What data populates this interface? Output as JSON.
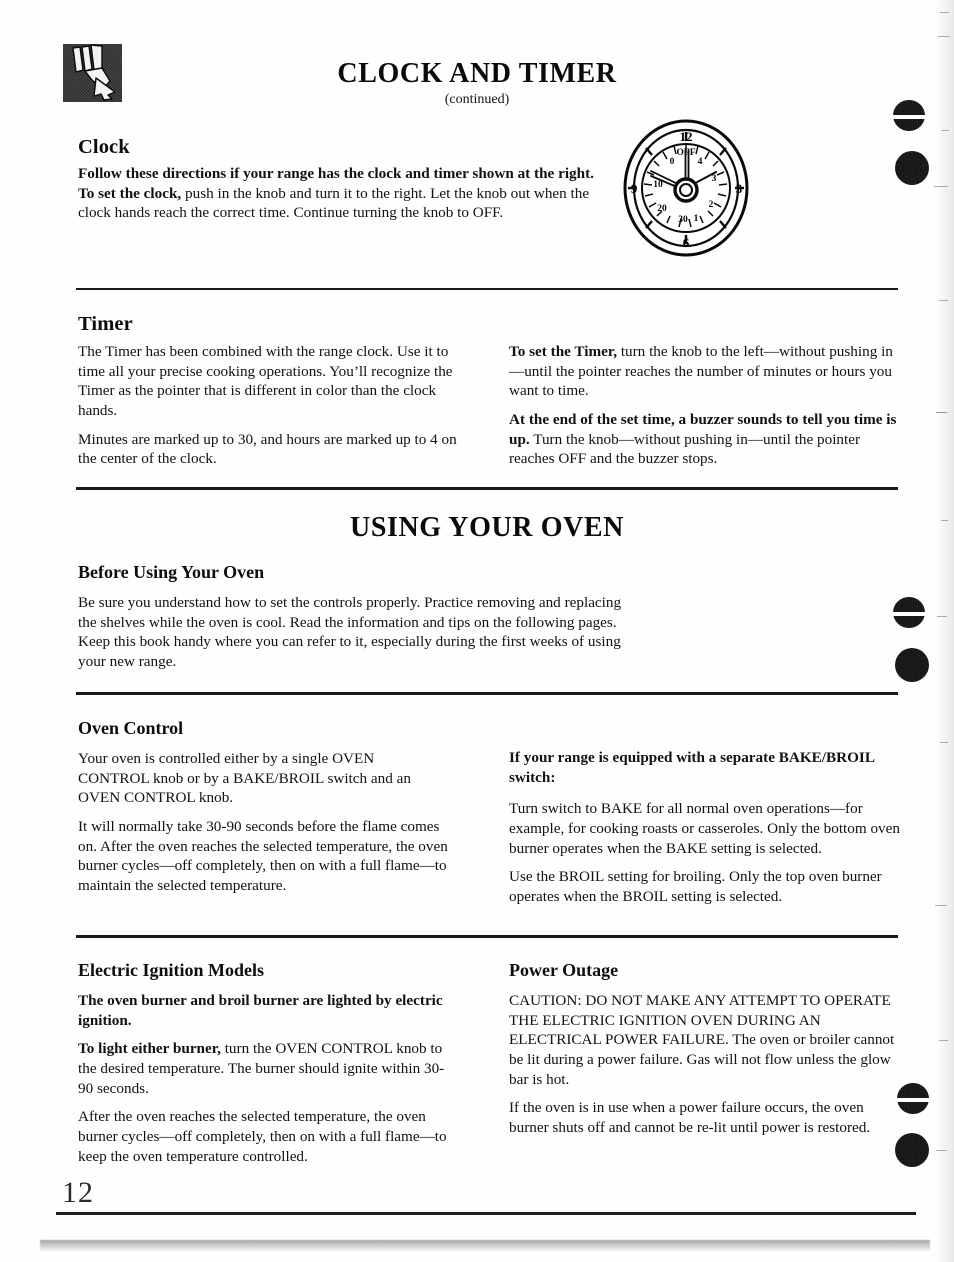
{
  "document": {
    "title": "CLOCK AND TIMER",
    "subtitle": "(continued)",
    "page_number": "12",
    "header_icon": "hand-pointing-down-icon"
  },
  "clock_figure": {
    "name": "clock-timer-dial-illustration",
    "outer_numbers": [
      "12",
      "3",
      "6",
      "9"
    ],
    "inner_labels": [
      "OFF",
      "0",
      "4",
      "3",
      "2",
      "1",
      "30",
      "20",
      "10"
    ],
    "center_label": "OFF"
  },
  "sections": [
    {
      "id": "clock",
      "heading": "Clock",
      "paragraphs": [
        {
          "runs": [
            {
              "text": "Follow these directions if your range has the clock and timer shown at the right. To set the clock,",
              "bold": true
            },
            {
              "text": " push in the knob and turn it to the right. Let the knob out when the clock hands reach the correct time. Continue turning the knob to OFF.",
              "bold": false
            }
          ]
        }
      ]
    },
    {
      "id": "timer",
      "heading": "Timer",
      "left_paragraphs": [
        {
          "runs": [
            {
              "text": "The Timer has been combined with the range clock. Use it to time all your precise cooking operations. You’ll recognize the Timer as the pointer that is different in color than the clock hands.",
              "bold": false
            }
          ]
        },
        {
          "runs": [
            {
              "text": "Minutes are marked up to 30, and hours are marked up to 4 on the center of the clock.",
              "bold": false
            }
          ]
        }
      ],
      "right_paragraphs": [
        {
          "runs": [
            {
              "text": "To set the Timer,",
              "bold": true
            },
            {
              "text": " turn the knob to the left—without pushing in—until the pointer reaches the number of minutes or hours you want to time.",
              "bold": false
            }
          ]
        },
        {
          "runs": [
            {
              "text": "At the end of the set time, a buzzer sounds to tell you time is up.",
              "bold": true
            },
            {
              "text": " Turn the knob—without pushing in—until the pointer reaches OFF and the buzzer stops.",
              "bold": false
            }
          ]
        }
      ]
    },
    {
      "id": "using-your-oven",
      "banner": "USING YOUR OVEN",
      "heading": "Before Using Your Oven",
      "paragraphs": [
        {
          "runs": [
            {
              "text": "Be sure you understand how to set the controls properly. Practice removing and replacing the shelves while the oven is cool. Read the information and tips on the following pages. Keep this book handy where you can refer to it, especially during the first weeks of using your new range.",
              "bold": false
            }
          ]
        }
      ]
    },
    {
      "id": "oven-control",
      "heading": "Oven Control",
      "left_paragraphs": [
        {
          "runs": [
            {
              "text": "Your oven is controlled either by a single OVEN CONTROL knob or by a BAKE/BROIL switch and an OVEN CONTROL knob.",
              "bold": false
            }
          ]
        },
        {
          "runs": [
            {
              "text": "It will normally take 30-90 seconds before the flame comes on. After the oven reaches the selected temperature, the oven burner cycles—off completely, then on with a full flame—to maintain the selected temperature.",
              "bold": false
            }
          ]
        }
      ],
      "right_heading_runs": [
        {
          "text": "If your range is equipped with a separate BAKE/BROIL switch:",
          "bold": true
        }
      ],
      "right_paragraphs": [
        {
          "runs": [
            {
              "text": "Turn switch to BAKE for all normal oven operations—for example, for cooking roasts or casseroles. Only the bottom oven burner operates when the BAKE setting is selected.",
              "bold": false
            }
          ]
        },
        {
          "runs": [
            {
              "text": "Use the BROIL setting for broiling. Only the top oven burner operates when the BROIL setting is selected.",
              "bold": false
            }
          ]
        }
      ]
    },
    {
      "id": "electric-ignition-models",
      "heading": "Electric Ignition Models",
      "left_paragraphs": [
        {
          "runs": [
            {
              "text": "The oven burner and broil burner are lighted by electric ignition.",
              "bold": true
            }
          ]
        },
        {
          "runs": [
            {
              "text": "To light either burner,",
              "bold": true
            },
            {
              "text": " turn the OVEN CONTROL knob to the desired temperature. The burner should ignite within 30-90 seconds.",
              "bold": false
            }
          ]
        },
        {
          "runs": [
            {
              "text": "After the oven reaches the selected temperature, the oven burner cycles—off completely, then on with a full flame—to keep the oven temperature controlled.",
              "bold": false
            }
          ]
        }
      ]
    },
    {
      "id": "power-outage",
      "heading": "Power Outage",
      "paragraphs": [
        {
          "runs": [
            {
              "text": "CAUTION: DO NOT MAKE ANY ATTEMPT TO OPERATE THE ELECTRIC IGNITION OVEN DURING AN ELECTRICAL POWER FAILURE. The oven or broiler cannot be lit during a power failure. Gas will not flow unless the glow bar is hot.",
              "bold": false
            }
          ]
        },
        {
          "runs": [
            {
              "text": "If the oven is in use when a power failure occurs, the oven burner shuts off and cannot be re-lit until power is restored.",
              "bold": false
            }
          ]
        }
      ]
    }
  ]
}
